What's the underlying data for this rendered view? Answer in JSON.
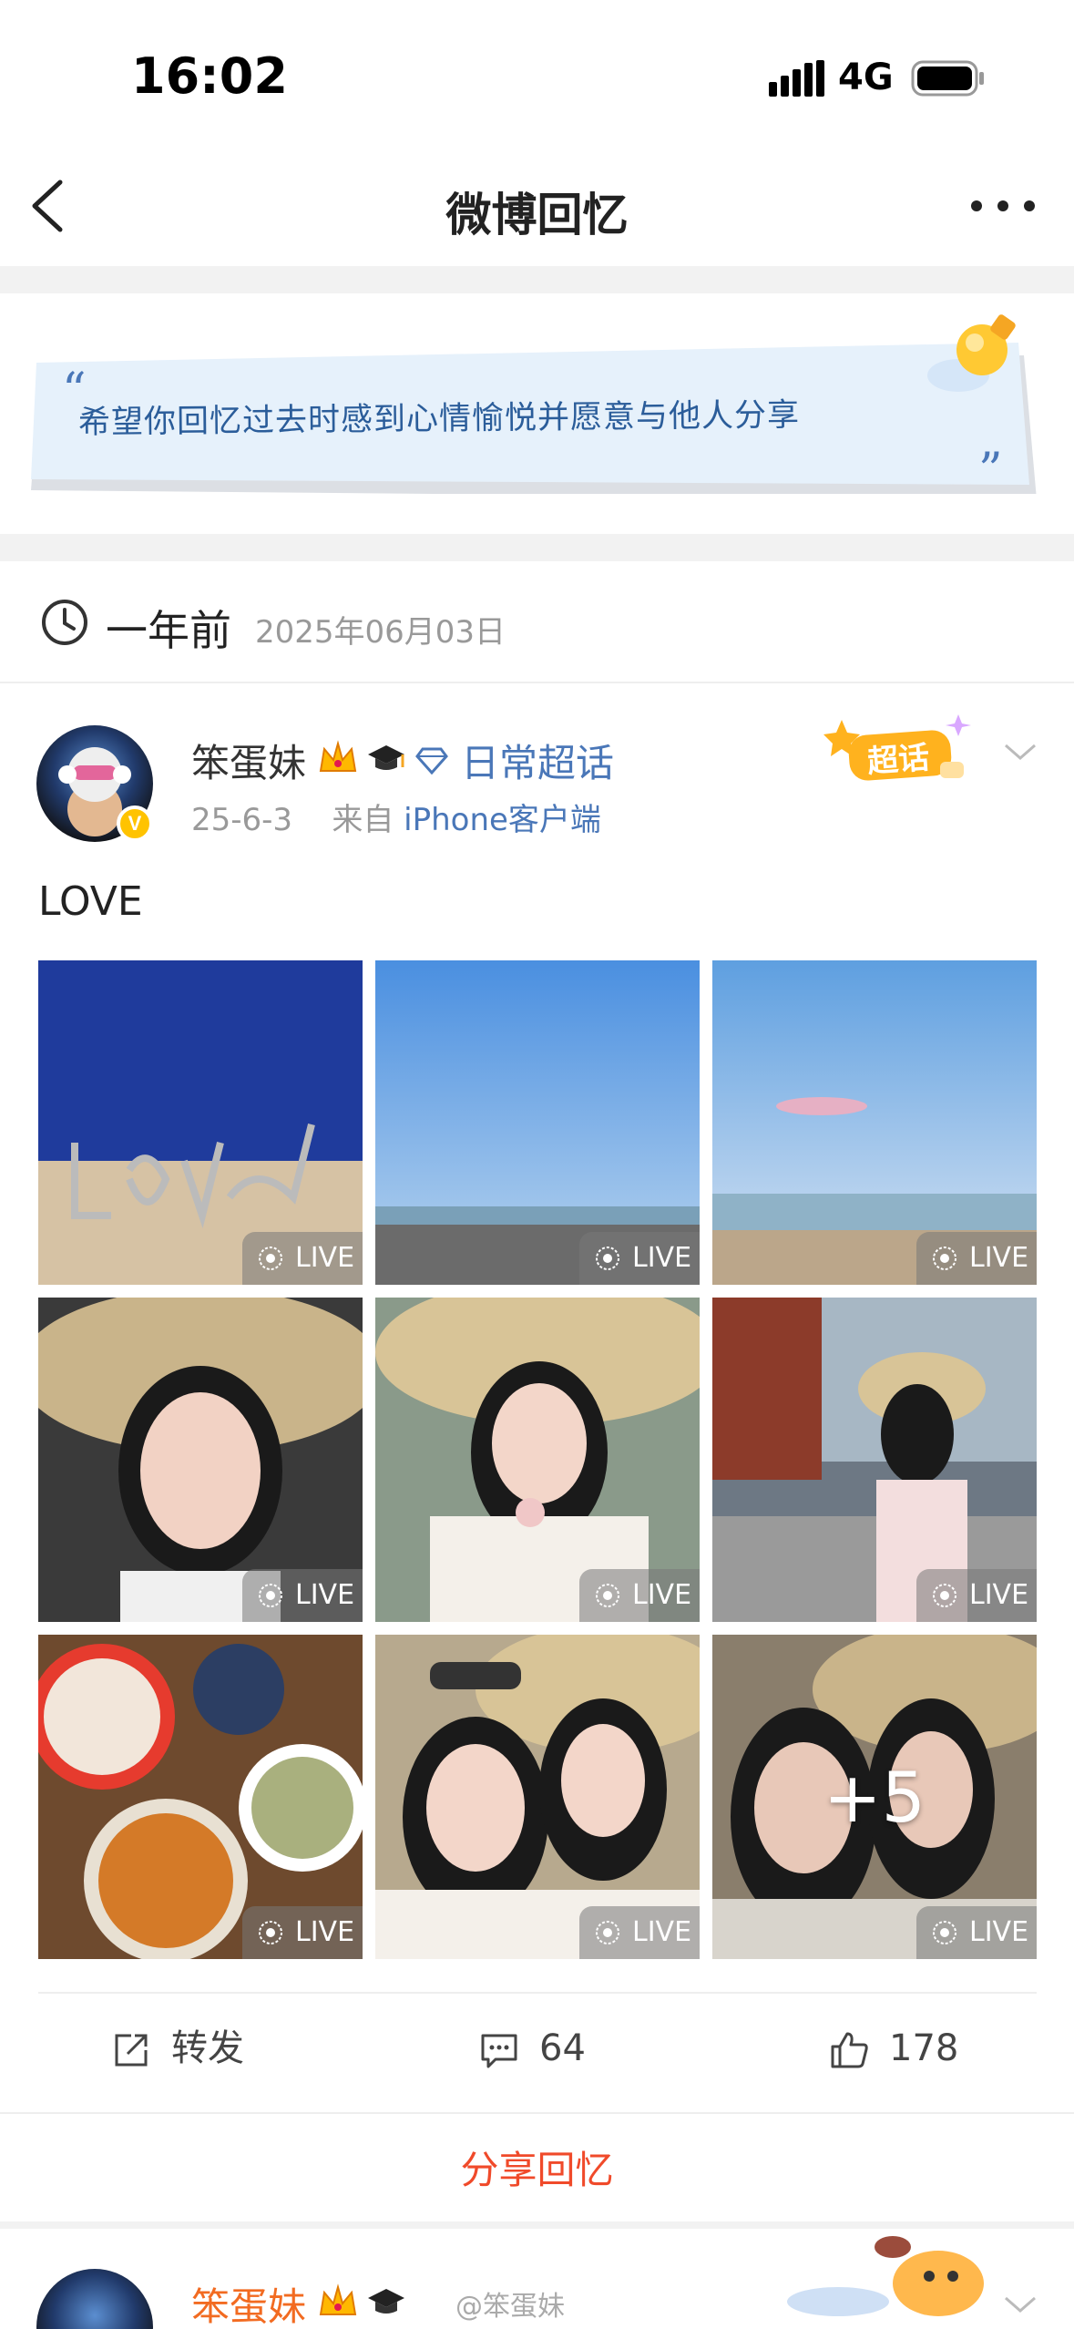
{
  "status_bar": {
    "time": "16:02",
    "network": "4G"
  },
  "nav": {
    "title": "微博回忆"
  },
  "quote": {
    "text": "希望你回忆过去时感到心情愉悦并愿意与他人分享"
  },
  "memory": {
    "ago": "一年前",
    "date": "2025年06月03日"
  },
  "post": {
    "username": "笨蛋妹",
    "topic": "日常超话",
    "date": "25-6-3",
    "source_prefix": "来自",
    "source": "iPhone客户端",
    "super_badge": "超话",
    "text": "LOVE",
    "live_label": "LIVE",
    "more_count": "+5",
    "actions": {
      "repost": "转发",
      "comments": "64",
      "likes": "178"
    },
    "share": "分享回忆"
  },
  "next_post": {
    "username": "笨蛋妹",
    "watermark": "@笨蛋妹"
  },
  "colors": {
    "link": "#4a77b8",
    "share": "#f04a2a",
    "quote": "#2b5d9a",
    "next_user": "#f26b21"
  }
}
